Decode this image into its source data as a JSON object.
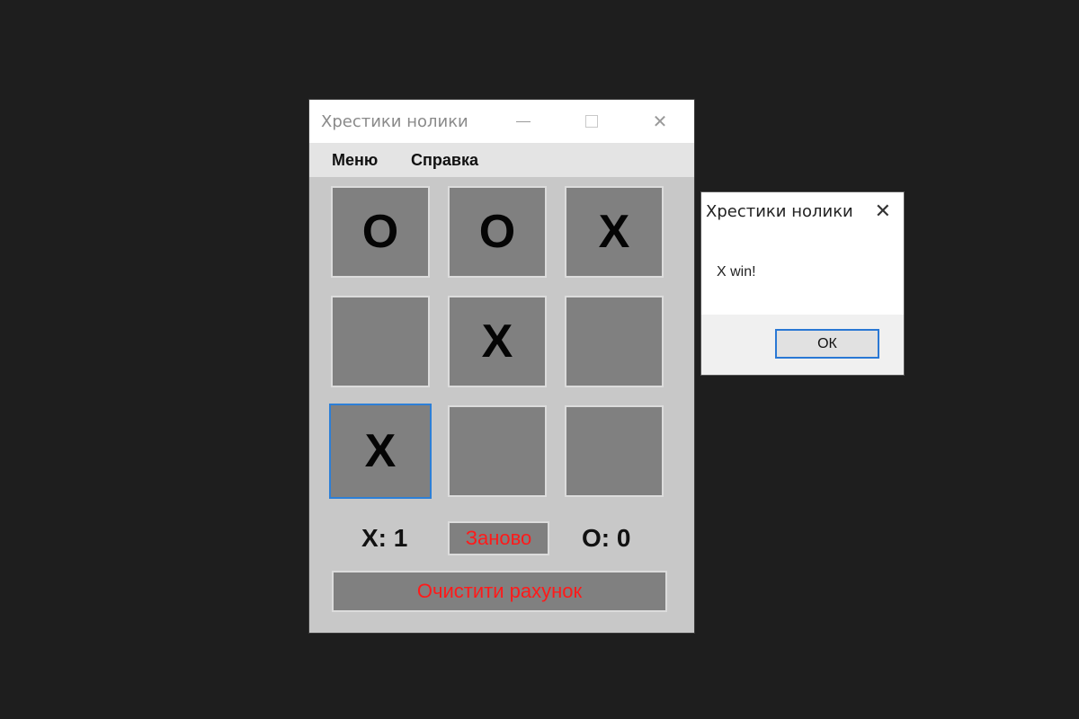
{
  "window": {
    "title": "Хрестики нолики",
    "close_glyph": "✕"
  },
  "menu": {
    "items": [
      {
        "label": "Меню"
      },
      {
        "label": "Справка"
      }
    ]
  },
  "board": {
    "cells": [
      "O",
      "O",
      "X",
      "",
      "X",
      "",
      "X",
      "",
      ""
    ]
  },
  "score": {
    "x": "X: 1",
    "o": "O: 0"
  },
  "buttons": {
    "restart": "Заново",
    "clear_score": "Очистити рахунок"
  },
  "dialog": {
    "title": "Хрестики нолики",
    "message": "X win!",
    "ok": "ОК",
    "close_glyph": "✕"
  },
  "colors": {
    "accent_text": "#ff1a1a",
    "cell_bg": "#808080",
    "focus": "#2d7fd6"
  },
  "icons": [
    "minimize-icon",
    "maximize-icon",
    "close-icon"
  ]
}
